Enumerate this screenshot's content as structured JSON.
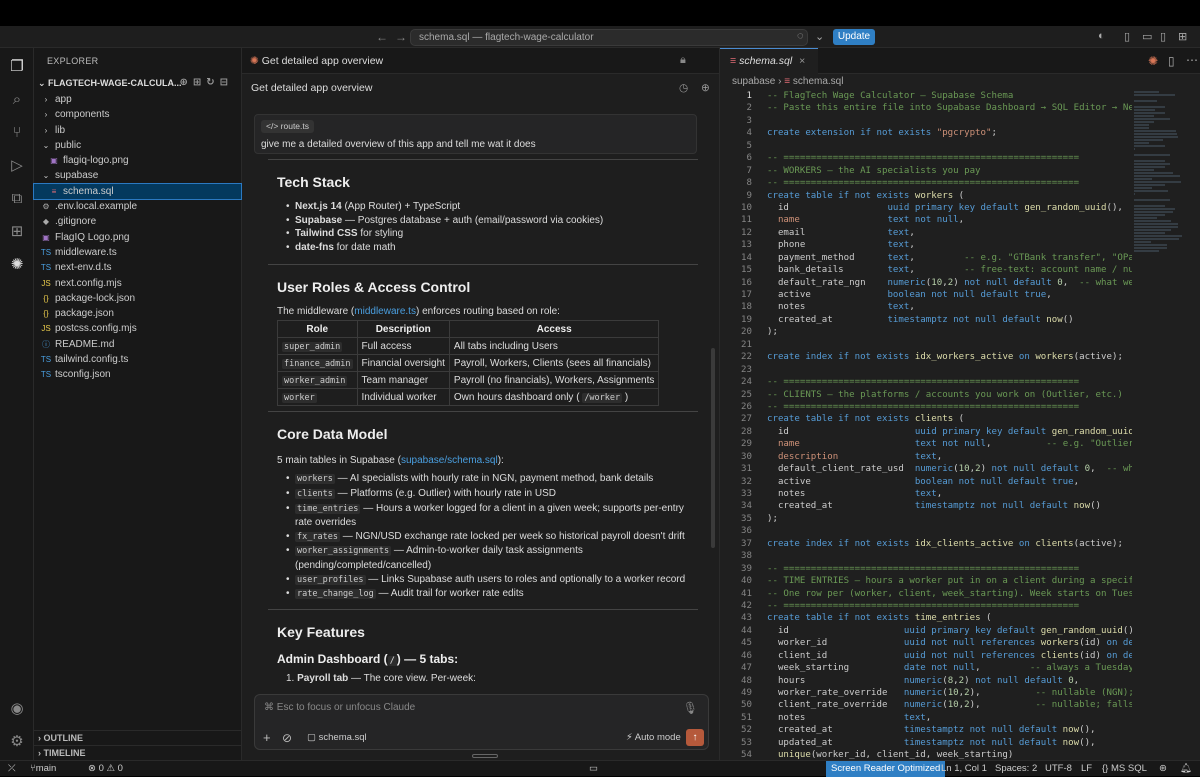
{
  "titlebar": {
    "center": "schema.sql — flagtech-wage-calculator",
    "update": "Update"
  },
  "explorer": {
    "header": "EXPLORER",
    "project": "FLAGTECH-WAGE-CALCULA...",
    "items": [
      {
        "label": "app",
        "icon": "›",
        "indent": 1,
        "color": "#ccc"
      },
      {
        "label": "components",
        "icon": "›",
        "indent": 1,
        "color": "#ccc"
      },
      {
        "label": "lib",
        "icon": "›",
        "indent": 1,
        "color": "#ccc"
      },
      {
        "label": "public",
        "icon": "⌄",
        "indent": 1,
        "color": "#ccc"
      },
      {
        "label": "flagiq-logo.png",
        "icon": "▣",
        "indent": 2,
        "color": "#a074c4"
      },
      {
        "label": "supabase",
        "icon": "⌄",
        "indent": 1,
        "color": "#ccc"
      },
      {
        "label": "schema.sql",
        "icon": "≡",
        "indent": 2,
        "color": "#e06c75",
        "selected": true
      },
      {
        "label": ".env.local.example",
        "icon": "⚙",
        "indent": 1,
        "color": "#aaa"
      },
      {
        "label": ".gitignore",
        "icon": "◆",
        "indent": 1,
        "color": "#aaa"
      },
      {
        "label": "FlagIQ Logo.png",
        "icon": "▣",
        "indent": 1,
        "color": "#a074c4"
      },
      {
        "label": "middleware.ts",
        "icon": "TS",
        "indent": 1,
        "color": "#4a9fe0"
      },
      {
        "label": "next-env.d.ts",
        "icon": "TS",
        "indent": 1,
        "color": "#4a9fe0"
      },
      {
        "label": "next.config.mjs",
        "icon": "JS",
        "indent": 1,
        "color": "#e6c84a"
      },
      {
        "label": "package-lock.json",
        "icon": "{}",
        "indent": 1,
        "color": "#e6c84a"
      },
      {
        "label": "package.json",
        "icon": "{}",
        "indent": 1,
        "color": "#e6c84a"
      },
      {
        "label": "postcss.config.mjs",
        "icon": "JS",
        "indent": 1,
        "color": "#e6c84a"
      },
      {
        "label": "README.md",
        "icon": "ⓘ",
        "indent": 1,
        "color": "#4a9fe0"
      },
      {
        "label": "tailwind.config.ts",
        "icon": "TS",
        "indent": 1,
        "color": "#4a9fe0"
      },
      {
        "label": "tsconfig.json",
        "icon": "TS",
        "indent": 1,
        "color": "#4a9fe0"
      }
    ],
    "outline": "OUTLINE",
    "timeline": "TIMELINE"
  },
  "chat": {
    "tab": "Get detailed app overview",
    "title": "Get detailed app overview",
    "chip": "route.ts",
    "prompt": "give me a detailed overview of this app and tell me wat it does",
    "tech_stack": {
      "heading": "Tech Stack",
      "items": [
        {
          "b": "Next.js 14",
          "t": " (App Router) + TypeScript"
        },
        {
          "b": "Supabase",
          "t": " — Postgres database + auth (email/password via cookies)"
        },
        {
          "b": "Tailwind CSS",
          "t": " for styling"
        },
        {
          "b": "date-fns",
          "t": " for date math"
        }
      ]
    },
    "roles": {
      "heading": "User Roles & Access Control",
      "intro_pre": "The middleware (",
      "intro_link": "middleware.ts",
      "intro_post": ") enforces routing based on role:",
      "cols": [
        "Role",
        "Description",
        "Access"
      ],
      "rows": [
        [
          "super_admin",
          "Full access",
          "All tabs including Users",
          ""
        ],
        [
          "finance_admin",
          "Financial oversight",
          "Payroll, Workers, Clients (sees all financials)",
          ""
        ],
        [
          "worker_admin",
          "Team manager",
          "Payroll (no financials), Workers, Assignments",
          ""
        ],
        [
          "worker",
          "Individual worker",
          "Own hours dashboard only ( ",
          "/worker"
        ]
      ]
    },
    "core": {
      "heading": "Core Data Model",
      "intro_pre": "5 main tables in Supabase (",
      "intro_link": "supabase/schema.sql",
      "intro_post": "):",
      "items": [
        {
          "c": "workers",
          "t": " — AI specialists with hourly rate in NGN, payment method, bank details"
        },
        {
          "c": "clients",
          "t": " — Platforms (e.g. Outlier) with hourly rate in USD"
        },
        {
          "c": "time_entries",
          "t": " — Hours a worker logged for a client in a given week; supports per-entry rate overrides"
        },
        {
          "c": "fx_rates",
          "t": " — NGN/USD exchange rate locked per week so historical payroll doesn't drift"
        },
        {
          "c": "worker_assignments",
          "t": " — Admin-to-worker daily task assignments (pending/completed/cancelled)"
        },
        {
          "c": "user_profiles",
          "t": " — Links Supabase auth users to roles and optionally to a worker record"
        },
        {
          "c": "rate_change_log",
          "t": " — Audit trail for worker rate edits"
        }
      ]
    },
    "features": {
      "heading": "Key Features",
      "sub_pre": "Admin Dashboard (",
      "sub_code": "/",
      "sub_post": ") — 5 tabs:",
      "first_bold": "Payroll tab",
      "first_text": " — The core view. Per-week:"
    },
    "input": {
      "placeholder": "⌘ Esc to focus or unfocus Claude",
      "file": "schema.sql",
      "mode": "Auto mode"
    }
  },
  "editor": {
    "tab": "schema.sql",
    "breadcrumb_folder": "supabase",
    "breadcrumb_file": "schema.sql",
    "lines": [
      "<span class='cm'>-- FlagTech Wage Calculator — Supabase Schema</span>",
      "<span class='cm'>-- Paste this entire file into Supabase Dashboard → SQL Editor → New query</span>",
      "",
      "<span class='kw'>create extension if not exists</span> <span class='st'>\"pgcrypto\"</span>;",
      "",
      "<span class='cm'>-- ======================================================</span>",
      "<span class='cm'>-- WORKERS — the AI specialists you pay</span>",
      "<span class='cm'>-- ======================================================</span>",
      "<span class='kw'>create table if not exists</span> <span class='fn'>workers</span> (",
      "  id                  <span class='kw'>uuid primary key default</span> <span class='fn'>gen_random_uuid</span>(),",
      "  <span class='st'>name</span>                <span class='kw'>text not null</span>,",
      "  email               <span class='kw'>text</span>,",
      "  phone               <span class='kw'>text</span>,",
      "  payment_method      <span class='kw'>text</span>,         <span class='cm'>-- e.g. \"GTBank transfer\", \"OPay\", \"USDT\"</span>",
      "  bank_details        <span class='kw'>text</span>,         <span class='cm'>-- free-text: account name / number / bank</span>",
      "  default_rate_ngn    <span class='kw'>numeric</span>(<span class='nu'>10</span>,<span class='nu'>2</span>) <span class='kw'>not null default</span> <span class='nu'>0</span>,  <span class='cm'>-- what we pay per hour</span>",
      "  active              <span class='kw'>boolean not null default true</span>,",
      "  notes               <span class='kw'>text</span>,",
      "  created_at          <span class='kw'>timestamptz not null default</span> <span class='fn'>now</span>()",
      ");",
      "",
      "<span class='kw'>create index if not exists</span> <span class='fn'>idx_workers_active</span> <span class='kw'>on</span> <span class='fn'>workers</span>(active);",
      "",
      "<span class='cm'>-- ======================================================</span>",
      "<span class='cm'>-- CLIENTS — the platforms / accounts you work on (Outlier, etc.)</span>",
      "<span class='cm'>-- ======================================================</span>",
      "<span class='kw'>create table if not exists</span> <span class='fn'>clients</span> (",
      "  id                       <span class='kw'>uuid primary key default</span> <span class='fn'>gen_random_uuid</span>(),",
      "  <span class='st'>name</span>                     <span class='kw'>text not null</span>,          <span class='cm'>-- e.g. \"Outlier - Coding Tasks\"</span>",
      "  <span class='st'>description</span>              <span class='kw'>text</span>,",
      "  default_client_rate_usd  <span class='kw'>numeric</span>(<span class='nu'>10</span>,<span class='nu'>2</span>) <span class='kw'>not null default</span> <span class='nu'>0</span>,  <span class='cm'>-- what the client pays</span>",
      "  active                   <span class='kw'>boolean not null default true</span>,",
      "  notes                    <span class='kw'>text</span>,",
      "  created_at               <span class='kw'>timestamptz not null default</span> <span class='fn'>now</span>()",
      ");",
      "",
      "<span class='kw'>create index if not exists</span> <span class='fn'>idx_clients_active</span> <span class='kw'>on</span> <span class='fn'>clients</span>(active);",
      "",
      "<span class='cm'>-- ======================================================</span>",
      "<span class='cm'>-- TIME ENTRIES — hours a worker put in on a client during a specific week</span>",
      "<span class='cm'>-- One row per (worker, client, week_starting). Week starts on Tuesday.</span>",
      "<span class='cm'>-- ======================================================</span>",
      "<span class='kw'>create table if not exists</span> <span class='fn'>time_entries</span> (",
      "  id                     <span class='kw'>uuid primary key default</span> <span class='fn'>gen_random_uuid</span>(),",
      "  worker_id              <span class='kw'>uuid not null references</span> <span class='fn'>workers</span>(id) <span class='kw'>on delete</span> cascade,",
      "  client_id              <span class='kw'>uuid not null references</span> <span class='fn'>clients</span>(id) <span class='kw'>on delete</span> cascade,",
      "  week_starting          <span class='kw'>date not null</span>,         <span class='cm'>-- always a Tuesday</span>",
      "  hours                  <span class='kw'>numeric</span>(<span class='nu'>8</span>,<span class='nu'>2</span>) <span class='kw'>not null default</span> <span class='nu'>0</span>,",
      "  worker_rate_override   <span class='kw'>numeric</span>(<span class='nu'>10</span>,<span class='nu'>2</span>),          <span class='cm'>-- nullable (NGN); falls back to worker</span>",
      "  client_rate_override   <span class='kw'>numeric</span>(<span class='nu'>10</span>,<span class='nu'>2</span>),          <span class='cm'>-- nullable; falls back to client</span>",
      "  notes                  <span class='kw'>text</span>,",
      "  created_at             <span class='kw'>timestamptz not null default</span> <span class='fn'>now</span>(),",
      "  updated_at             <span class='kw'>timestamptz not null default</span> <span class='fn'>now</span>(),",
      "  <span class='fn'>unique</span>(worker_id, client_id, week_starting)"
    ]
  },
  "status": {
    "branch": "main",
    "problems": "⊗ 0  ⚠ 0",
    "sr": "Screen Reader Optimized",
    "pos": "Ln 1, Col 1",
    "spaces": "Spaces: 2",
    "enc": "UTF-8",
    "eol": "LF",
    "lang": "{} MS SQL"
  }
}
